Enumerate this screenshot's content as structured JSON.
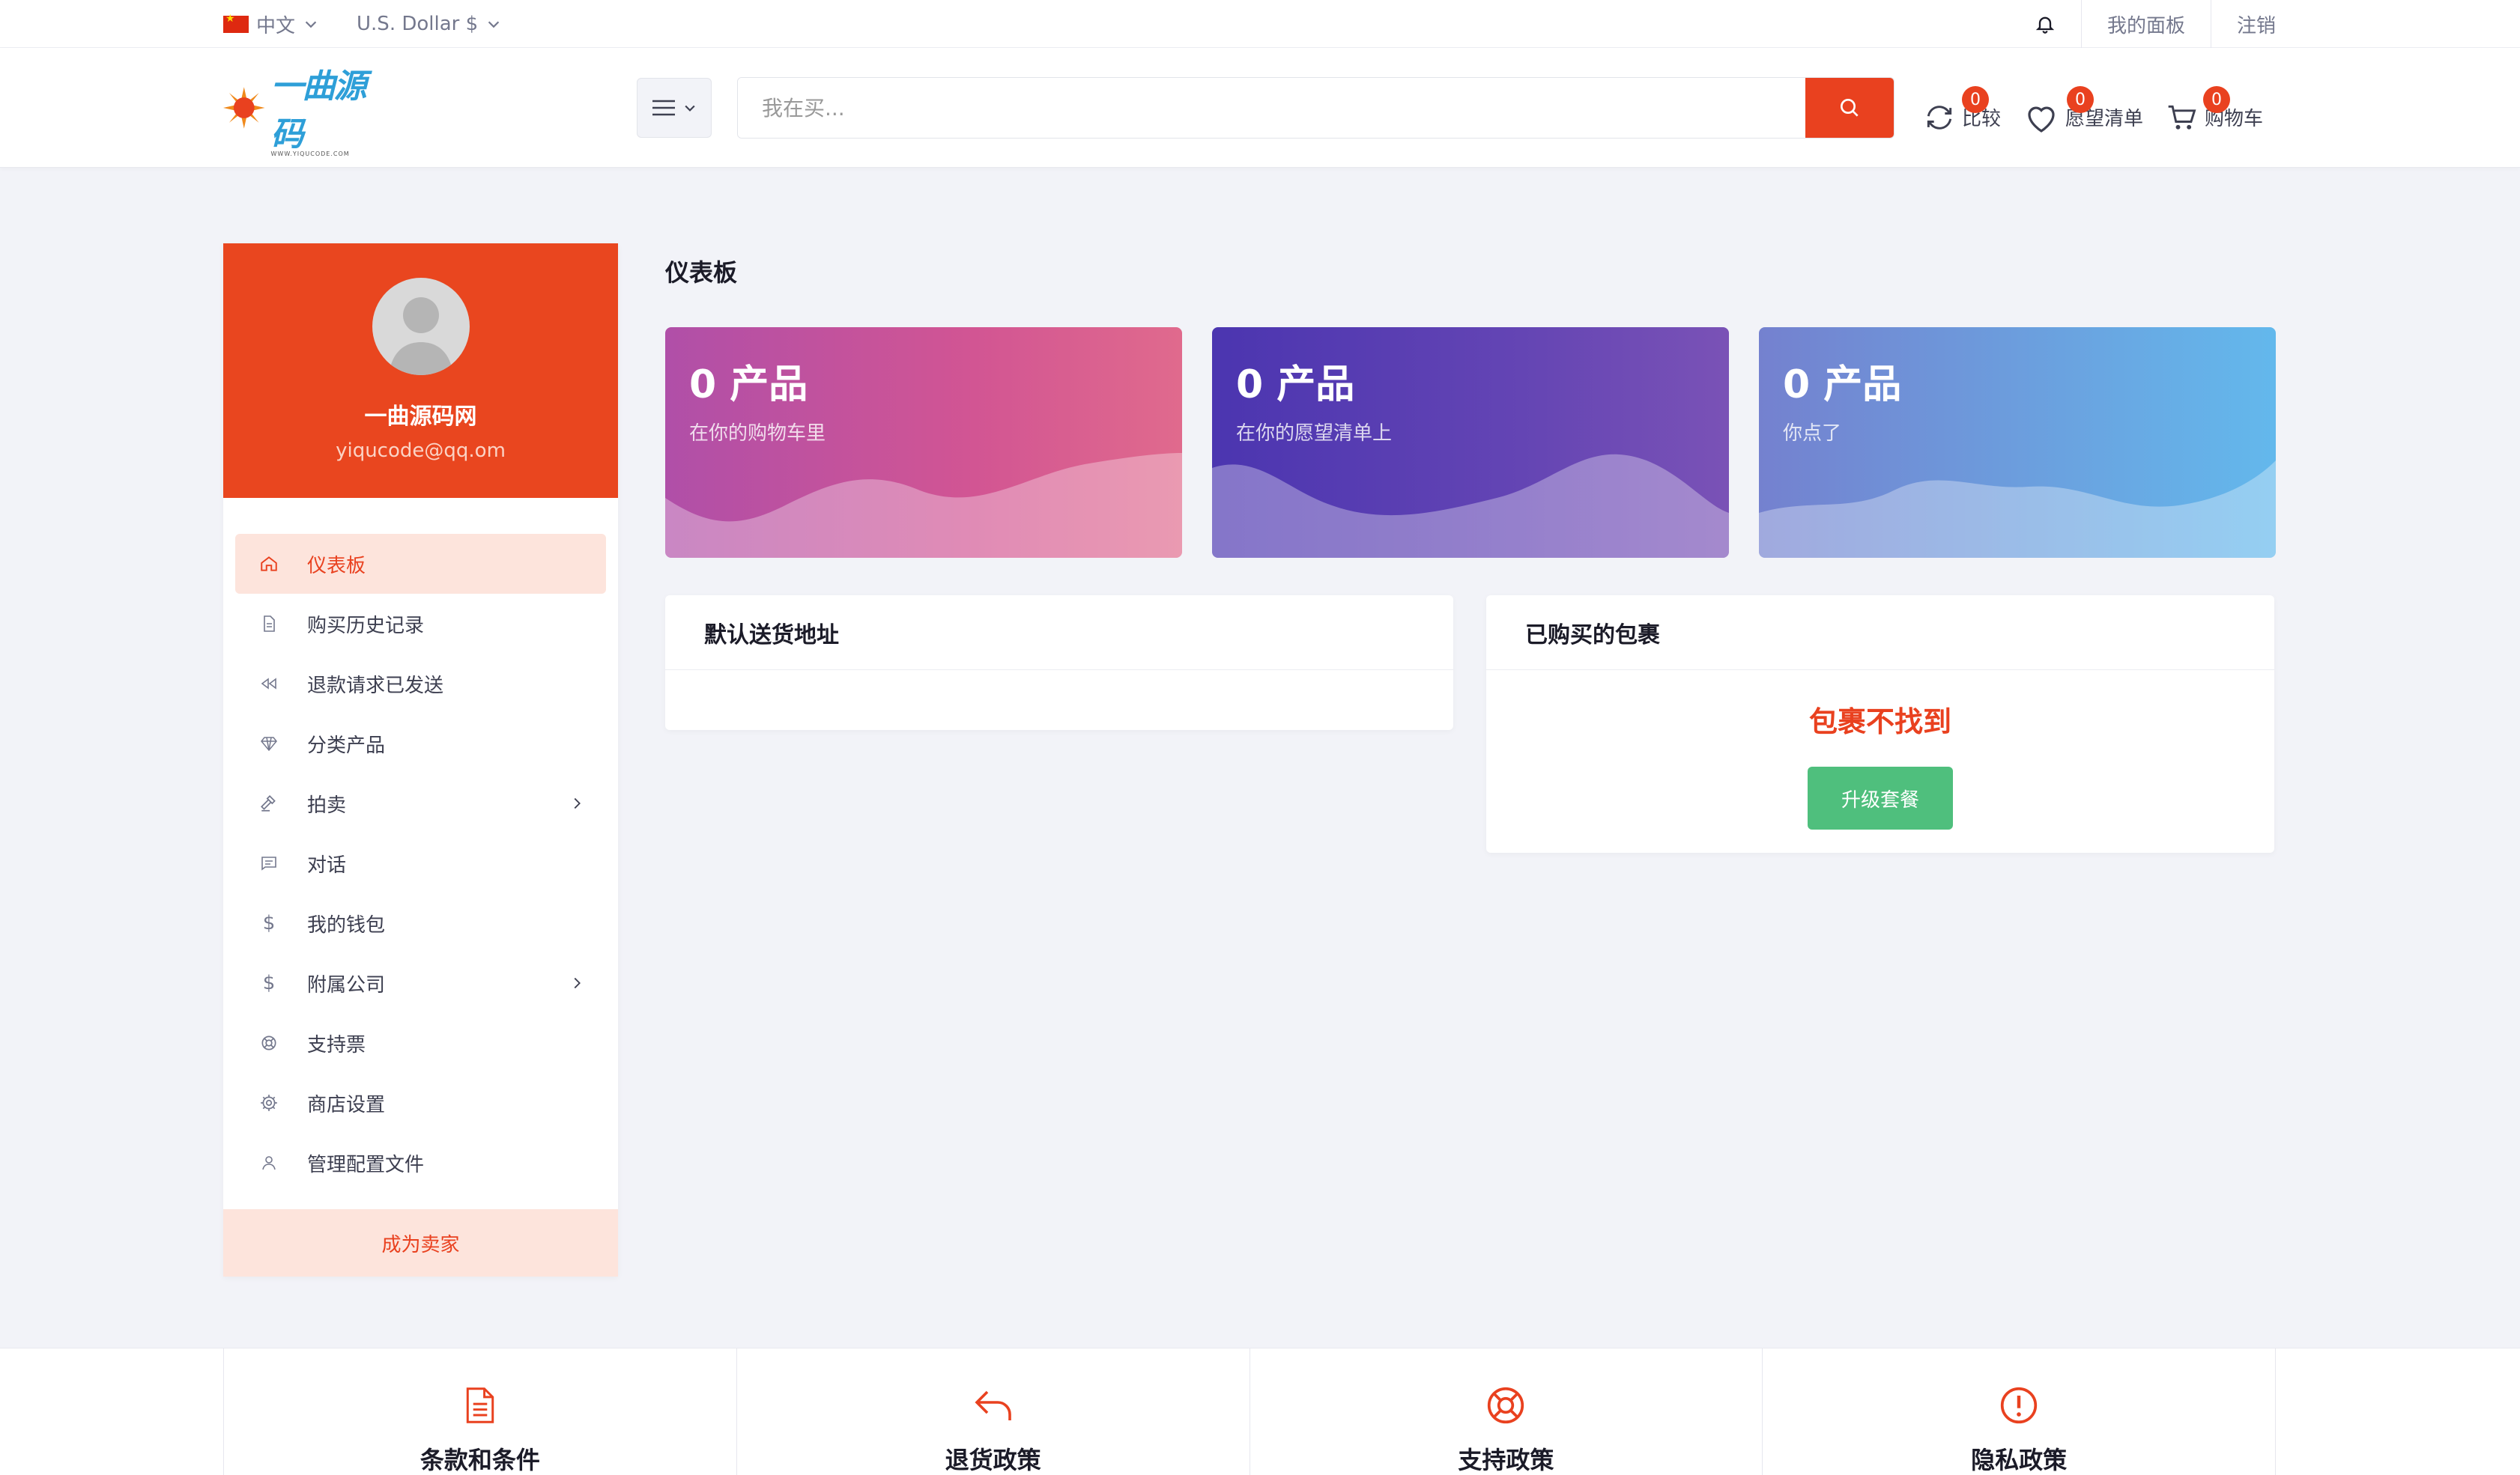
{
  "topbar": {
    "language": "中文",
    "currency": "U.S. Dollar $",
    "my_panel": "我的面板",
    "logout": "注销"
  },
  "header": {
    "logo_text": "一曲源码",
    "logo_sub": "WWW.YIQUCODE.COM",
    "search_placeholder": "我在买...",
    "compare": {
      "label": "比较",
      "count": "0"
    },
    "wishlist": {
      "label": "愿望清单",
      "count": "0"
    },
    "cart": {
      "label": "购物车",
      "count": "0"
    }
  },
  "profile": {
    "name": "一曲源码网",
    "email": "yiqucode@qq.om"
  },
  "sidebar": {
    "items": [
      {
        "label": "仪表板",
        "icon": "home-icon",
        "active": true
      },
      {
        "label": "购买历史记录",
        "icon": "file-icon"
      },
      {
        "label": "退款请求已发送",
        "icon": "rewind-icon"
      },
      {
        "label": "分类产品",
        "icon": "diamond-icon"
      },
      {
        "label": "拍卖",
        "icon": "gavel-icon",
        "expandable": true
      },
      {
        "label": "对话",
        "icon": "chat-icon"
      },
      {
        "label": "我的钱包",
        "icon": "dollar-icon"
      },
      {
        "label": "附属公司",
        "icon": "dollar-icon",
        "expandable": true
      },
      {
        "label": "支持票",
        "icon": "support-icon"
      },
      {
        "label": "商店设置",
        "icon": "gear-icon"
      },
      {
        "label": "管理配置文件",
        "icon": "user-icon"
      }
    ],
    "become_seller": "成为卖家"
  },
  "main": {
    "title": "仪表板",
    "stats": [
      {
        "title": "0 产品",
        "subtitle": "在你的购物车里"
      },
      {
        "title": "0 产品",
        "subtitle": "在你的愿望清单上"
      },
      {
        "title": "0 产品",
        "subtitle": "你点了"
      }
    ],
    "address_card": {
      "title": "默认送货地址"
    },
    "packages_card": {
      "title": "已购买的包裹",
      "empty_text": "包裹不找到",
      "upgrade_label": "升级套餐"
    }
  },
  "footer": {
    "items": [
      {
        "label": "条款和条件",
        "icon": "document-icon"
      },
      {
        "label": "退货政策",
        "icon": "return-arrow-icon"
      },
      {
        "label": "支持政策",
        "icon": "lifebuoy-icon"
      },
      {
        "label": "隐私政策",
        "icon": "alert-circle-icon"
      }
    ]
  },
  "colors": {
    "accent": "#e9411f",
    "success": "#4fbf7d",
    "logo_blue": "#2e9fd8"
  }
}
